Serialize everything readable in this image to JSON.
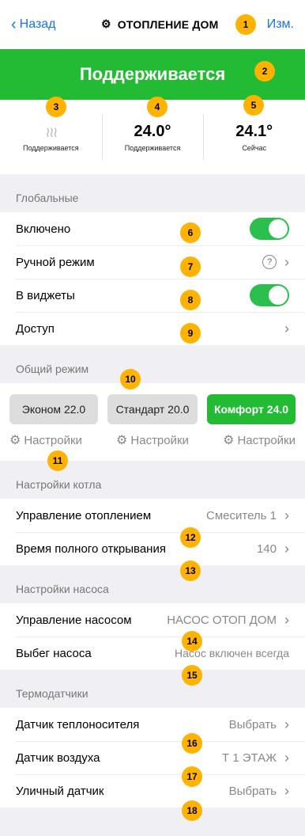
{
  "nav": {
    "back_label": "Назад",
    "title": "ОТОПЛЕНИЕ ДОМ",
    "edit_label": "Изм."
  },
  "status": {
    "label": "Поддерживается"
  },
  "summary": [
    {
      "value": "",
      "caption": "Поддерживается"
    },
    {
      "value": "24.0°",
      "caption": "Поддерживается"
    },
    {
      "value": "24.1°",
      "caption": "Сейчас"
    }
  ],
  "global": {
    "header": "Глобальные",
    "enabled": {
      "label": "Включено",
      "on": true
    },
    "manual": {
      "label": "Ручной режим",
      "help": "?"
    },
    "widgets": {
      "label": "В виджеты",
      "on": true
    },
    "access": {
      "label": "Доступ"
    }
  },
  "mode": {
    "header": "Общий режим",
    "buttons": [
      "Эконом 22.0",
      "Стандарт 20.0",
      "Комфорт 24.0"
    ],
    "active_index": 2,
    "settings_label": "Настройки"
  },
  "boiler": {
    "header": "Настройки котла",
    "control": {
      "label": "Управление отоплением",
      "value": "Смеситель 1"
    },
    "open_time": {
      "label": "Время полного открывания",
      "value": "140"
    }
  },
  "pump": {
    "header": "Настройки насоса",
    "control": {
      "label": "Управление насосом",
      "value": "НАСОС ОТОП ДОМ"
    },
    "overrun": {
      "label": "Выбег насоса",
      "value": "Насос включен всегда"
    }
  },
  "sensors": {
    "header": "Термодатчики",
    "coolant": {
      "label": "Датчик теплоносителя",
      "value": "Выбрать"
    },
    "air": {
      "label": "Датчик воздуха",
      "value": "Т 1 ЭТАЖ"
    },
    "street": {
      "label": "Уличный датчик",
      "value": "Выбрать"
    }
  },
  "badges": [
    "1",
    "2",
    "3",
    "4",
    "5",
    "6",
    "7",
    "8",
    "9",
    "10",
    "11",
    "12",
    "13",
    "14",
    "15",
    "16",
    "17",
    "18"
  ],
  "colors": {
    "accent": "#1a73e8",
    "active": "#22bb33",
    "badge": "#ffb300"
  }
}
